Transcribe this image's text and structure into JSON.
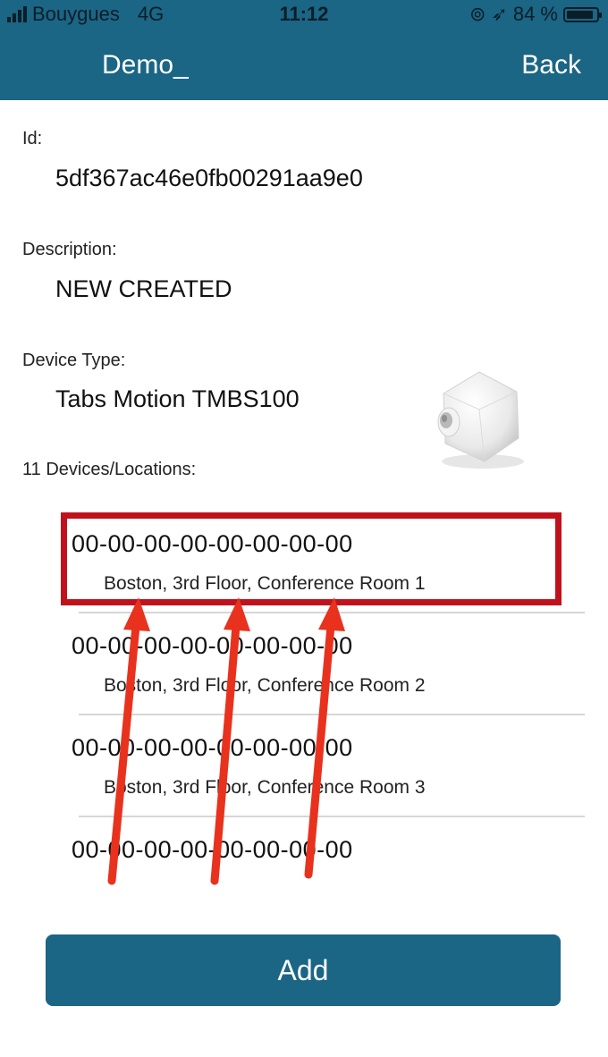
{
  "status_bar": {
    "carrier": "Bouygues",
    "network": "4G",
    "time": "11:12",
    "battery": "84 %"
  },
  "nav": {
    "title": "Demo_",
    "back_label": "Back"
  },
  "fields": {
    "id_label": "Id:",
    "id_value": "5df367ac46e0fb00291aa9e0",
    "description_label": "Description:",
    "description_value": "NEW CREATED",
    "device_type_label": "Device Type:",
    "device_type_value": "Tabs Motion TMBS100"
  },
  "devices": {
    "header": "11 Devices/Locations:",
    "items": [
      {
        "mac": "00-00-00-00-00-00-00-00",
        "location": "Boston, 3rd Floor, Conference Room 1"
      },
      {
        "mac": "00-00-00-00-00-00-00-00",
        "location": "Boston, 3rd Floor, Conference Room 2"
      },
      {
        "mac": "00-00-00-00-00-00-00-00",
        "location": "Boston, 3rd Floor, Conference Room 3"
      },
      {
        "mac": "00-00-00-00-00-00-00-00",
        "location": ""
      }
    ]
  },
  "add_button_label": "Add",
  "colors": {
    "brand": "#1b6585",
    "highlight": "#c0121c",
    "arrow": "#e8321e"
  }
}
